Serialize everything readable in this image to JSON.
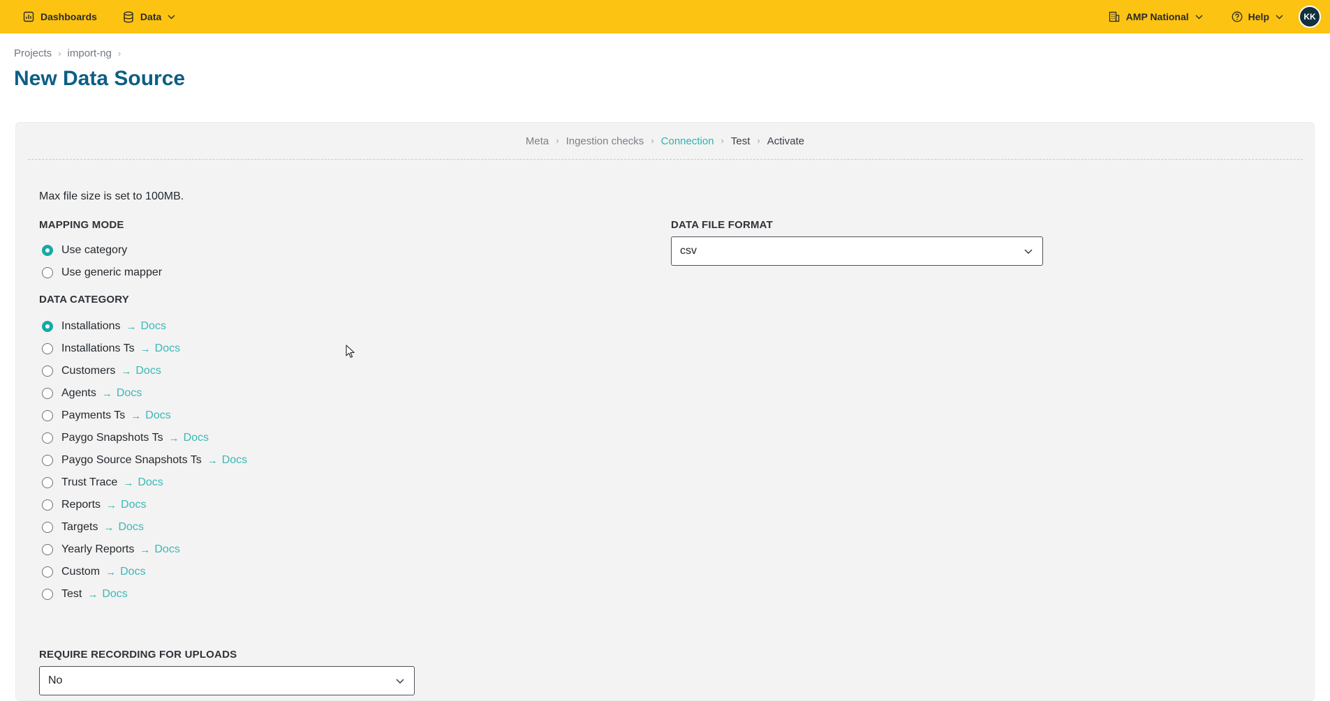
{
  "topbar": {
    "dashboards_label": "Dashboards",
    "data_label": "Data",
    "org_label": "AMP National",
    "help_label": "Help",
    "avatar_initials": "KK",
    "bg_color": "#fcc313"
  },
  "breadcrumb": {
    "items": [
      "Projects",
      "import-ng"
    ]
  },
  "page_title": "New Data Source",
  "stepper": {
    "steps": [
      "Meta",
      "Ingestion checks",
      "Connection",
      "Test",
      "Activate"
    ],
    "active_step": "Connection"
  },
  "form": {
    "max_file_note": "Max file size is set to 100MB.",
    "mapping_mode": {
      "label": "MAPPING MODE",
      "options": [
        "Use category",
        "Use generic mapper"
      ],
      "selected": "Use category"
    },
    "data_category": {
      "label": "DATA CATEGORY",
      "docs_arrow": "→",
      "docs_label": "Docs",
      "options": [
        "Installations",
        "Installations Ts",
        "Customers",
        "Agents",
        "Payments Ts",
        "Paygo Snapshots Ts",
        "Paygo Source Snapshots Ts",
        "Trust Trace",
        "Reports",
        "Targets",
        "Yearly Reports",
        "Custom",
        "Test"
      ],
      "selected": "Installations"
    },
    "data_file_format": {
      "label": "DATA FILE FORMAT",
      "value": "csv"
    },
    "require_recording": {
      "label": "REQUIRE RECORDING FOR UPLOADS",
      "value": "No"
    }
  },
  "colors": {
    "accent": "#16a9a5",
    "title": "#0d5e85"
  }
}
